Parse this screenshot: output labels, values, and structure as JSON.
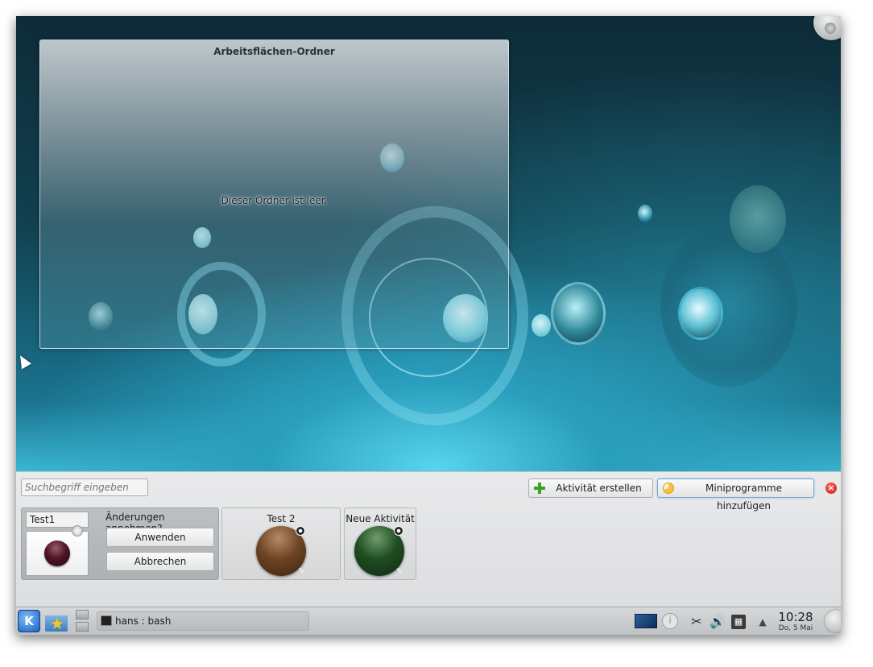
{
  "desktop": {
    "folderview_title": "Arbeitsflächen-Ordner",
    "folderview_empty_message": "Dieser Ordner ist leer."
  },
  "activity_manager": {
    "search_placeholder": "Suchbegriff eingeben",
    "create_activity_label": "Aktivität erstellen",
    "add_widgets_label": "Miniprogramme hinzufügen",
    "close_symbol": "×",
    "activities": [
      {
        "name": "Test1",
        "editing": true,
        "confirm_label": "Änderungen annehmen?",
        "apply_label": "Anwenden",
        "cancel_label": "Abbrechen",
        "orb_color": "#4d1425"
      },
      {
        "name": "Test 2",
        "orb_color": "#6e4424"
      },
      {
        "name": "Neue Aktivität",
        "orb_color": "#1f4d22"
      }
    ]
  },
  "taskbar": {
    "kickoff_glyph": "K",
    "tasks": [
      {
        "label": "hans : bash",
        "icon": "terminal-icon"
      }
    ],
    "tray": {
      "icons": [
        "screen-icon",
        "info-icon",
        "clipboard-icon",
        "volume-icon",
        "network-icon",
        "expand-arrow-icon"
      ],
      "clipboard_glyph": "✂",
      "volume_glyph": "🔊",
      "info_glyph": "i",
      "network_glyph": "▦",
      "expand_glyph": "▲"
    },
    "clock": {
      "time": "10:28",
      "date": "Do, 5 Mai"
    }
  },
  "colors": {
    "accent_blue": "#1a5fbf",
    "close_red": "#c9170c",
    "plus_green": "#3da12a"
  }
}
